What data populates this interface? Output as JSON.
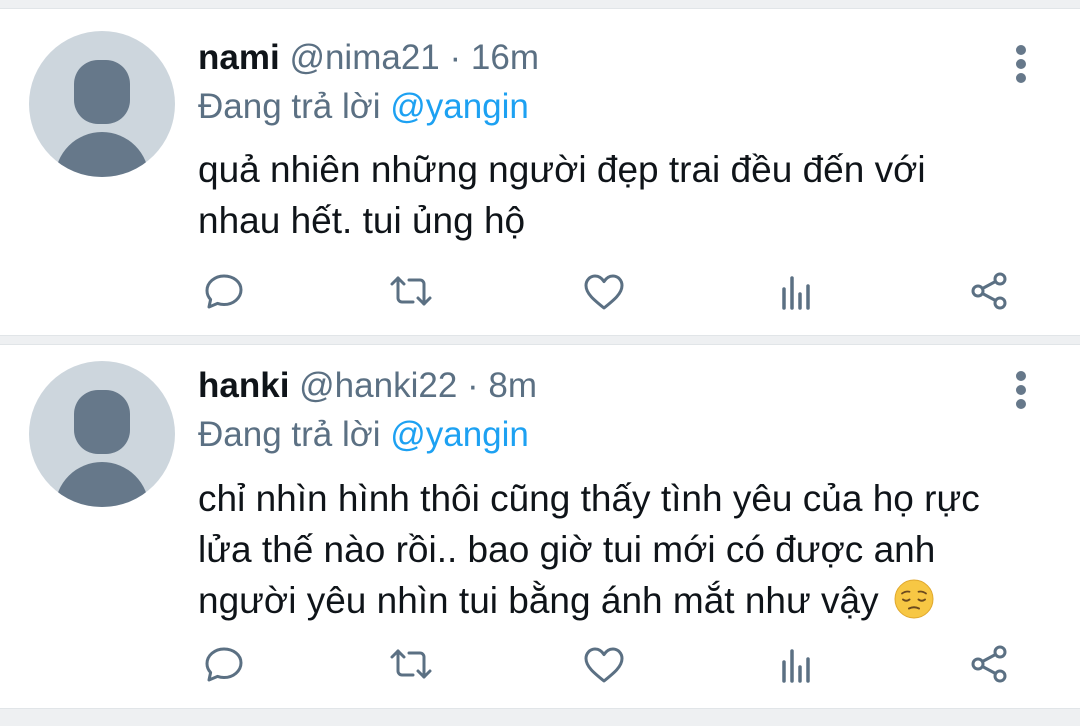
{
  "colors": {
    "text": "#0f1419",
    "secondary": "#5b7083",
    "mention": "#1da1f2",
    "divider": "#eef0f2",
    "avatar_bg": "#cdd6dd",
    "avatar_fg": "#66788a"
  },
  "tweets": [
    {
      "name": "nami",
      "handle": "@nima21",
      "separator": "·",
      "time": "16m",
      "reply_prefix": "Đang trả lời",
      "reply_to": "@yangin",
      "text": "quả nhiên những người đẹp trai đều đến với nhau hết. tui ủng hộ",
      "icons": {
        "reply": "reply-icon",
        "retweet": "retweet-icon",
        "like": "heart-icon",
        "stats": "analytics-icon",
        "share": "share-icon",
        "more": "more-vertical-icon"
      }
    },
    {
      "name": "hanki",
      "handle": "@hanki22",
      "separator": "·",
      "time": "8m",
      "reply_prefix": "Đang trả lời",
      "reply_to": "@yangin",
      "text": "chỉ nhìn hình thôi cũng thấy tình yêu của họ rực lửa thế nào rồi.. bao giờ tui mới có được anh người yêu nhìn tui bằng ánh mắt như vậy",
      "emoji": "pensive-face-emoji",
      "icons": {
        "reply": "reply-icon",
        "retweet": "retweet-icon",
        "like": "heart-icon",
        "stats": "analytics-icon",
        "share": "share-icon",
        "more": "more-vertical-icon"
      }
    }
  ]
}
